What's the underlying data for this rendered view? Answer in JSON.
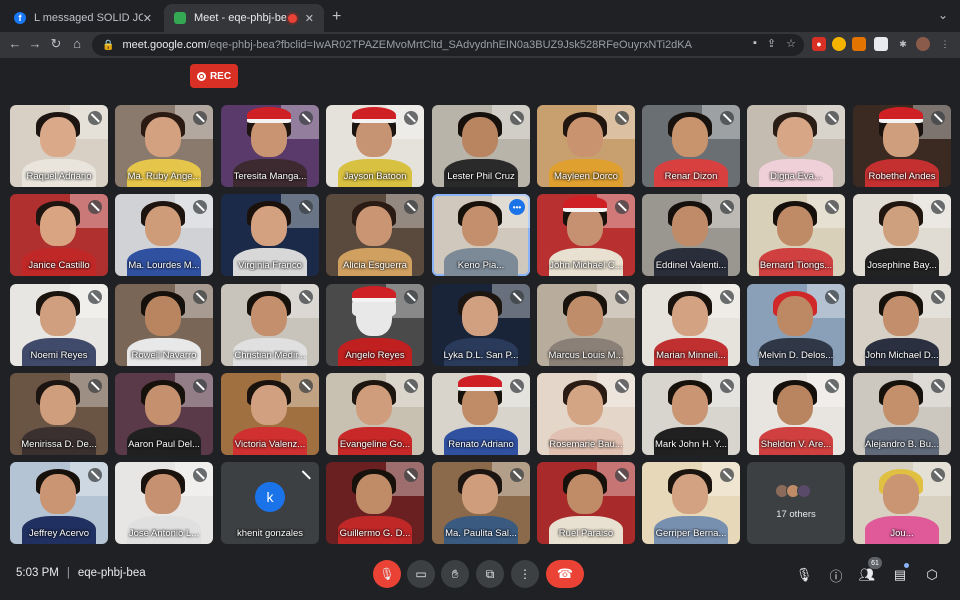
{
  "browser": {
    "tabs": [
      {
        "title": "L messaged SOLID JOKAK Ma",
        "favicon": "facebook-icon",
        "color": "#1877f2",
        "active": false
      },
      {
        "title": "Meet - eqe-phbj-bea",
        "favicon": "meet-icon",
        "color": "#34a853",
        "active": true
      }
    ],
    "url_host": "meet.google.com",
    "url_path": "/eqe-phbj-bea?fbclid=IwAR02TPAZEMvoMrtCltd_SAdvydnhEIN0a3BUZ9Jsk528RFeOuyrxNTi2dKA"
  },
  "meeting": {
    "rec_label": "REC",
    "time": "5:03 PM",
    "code": "eqe-phbj-bea",
    "participants_count": "61"
  },
  "participants": [
    {
      "name": "Raquel Adriano",
      "bg": "#d8d0c4",
      "skin": "#d9a98a",
      "hair": "#1b1410",
      "shirt": "#e9e4dc",
      "hat": false
    },
    {
      "name": "Ma. Ruby Ange...",
      "bg": "#8a7a6e",
      "skin": "#d3a080",
      "hair": "#2a1a12",
      "shirt": "#e6c64a",
      "hat": false
    },
    {
      "name": "Teresita Manga...",
      "bg": "#5a3a6a",
      "skin": "#c99472",
      "hair": "#1e1410",
      "shirt": "#3d2a30",
      "hat": true
    },
    {
      "name": "Jayson Batoon",
      "bg": "#e5e2dc",
      "skin": "#c79473",
      "hair": "#1c1410",
      "shirt": "#d8c040",
      "hat": true
    },
    {
      "name": "Lester Phil Cruz",
      "bg": "#b8b4aa",
      "skin": "#b98460",
      "hair": "#15100c",
      "shirt": "#2a2a2a",
      "hat": false
    },
    {
      "name": "Mayleen Dorco",
      "bg": "#c8a070",
      "skin": "#c9936f",
      "hair": "#20160f",
      "shirt": "#e0a030",
      "hat": false
    },
    {
      "name": "Renar Dizon",
      "bg": "#6a6f74",
      "skin": "#c8946e",
      "hair": "#18120e",
      "shirt": "#d84040",
      "hat": false
    },
    {
      "name": "Digna Eva...",
      "bg": "#c4bcb0",
      "skin": "#d6a687",
      "hair": "#2a1d16",
      "shirt": "#f0d0d8",
      "hat": false
    },
    {
      "name": "Robethel Andes",
      "bg": "#3a2a22",
      "skin": "#cf9e7c",
      "hair": "#1a120e",
      "shirt": "#c43030",
      "hat": true
    },
    {
      "name": "Janice Castillo",
      "bg": "#b03030",
      "skin": "#d8a482",
      "hair": "#1e1510",
      "shirt": "#c02828",
      "hat": false
    },
    {
      "name": "Ma. Lourdes M...",
      "bg": "#d0d2d6",
      "skin": "#cf9c7a",
      "hair": "#1d1410",
      "shirt": "#3050a0",
      "hat": false
    },
    {
      "name": "Virginia Franco",
      "bg": "#1a2a48",
      "skin": "#d3a080",
      "hair": "#1a110c",
      "shirt": "#d8d8d8",
      "hat": false
    },
    {
      "name": "Alicia Esguerra",
      "bg": "#5a4a3e",
      "skin": "#c99573",
      "hair": "#2a1c14",
      "shirt": "#d0a060",
      "hat": false
    },
    {
      "name": "Keno Pia...",
      "bg": "#d0c8bc",
      "skin": "#c48f6c",
      "hair": "#17110c",
      "shirt": "#7c8a98",
      "hat": false
    },
    {
      "name": "John Michael C...",
      "bg": "#b83030",
      "skin": "#c59170",
      "hair": "#1a120d",
      "shirt": "#e8e0d0",
      "hat": true
    },
    {
      "name": "Eddinel Valenti...",
      "bg": "#9a9690",
      "skin": "#c08b68",
      "hair": "#16100c",
      "shirt": "#2a2e3a",
      "hat": false
    },
    {
      "name": "Bernard Tiongs...",
      "bg": "#d8d0b8",
      "skin": "#bf8a66",
      "hair": "#16100c",
      "shirt": "#d04040",
      "hat": false
    },
    {
      "name": "Josephine Bay...",
      "bg": "#e0dcd4",
      "skin": "#cfa07e",
      "hair": "#20160f",
      "shirt": "#222222",
      "hat": false
    },
    {
      "name": "Noemi Reyes",
      "bg": "#e8e6e2",
      "skin": "#cf9f80",
      "hair": "#1b130e",
      "shirt": "#404a6a",
      "hat": false
    },
    {
      "name": "Rowell Navarro",
      "bg": "#7a6656",
      "skin": "#b98560",
      "hair": "#15100c",
      "shirt": "#e8e8e8",
      "hat": false
    },
    {
      "name": "Christian Medir...",
      "bg": "#c8c4bc",
      "skin": "#c48f6c",
      "hair": "#17110c",
      "shirt": "#e0e0e0",
      "hat": false
    },
    {
      "name": "Angelo Reyes",
      "bg": "#4a4a4a",
      "skin": "#e8e8e8",
      "hair": "#e8e8e8",
      "shirt": "#c02020",
      "hat": true
    },
    {
      "name": "Lyka D.L. San P...",
      "bg": "#1a2438",
      "skin": "#d0a080",
      "hair": "#1d1510",
      "shirt": "#2a3a5a",
      "hat": false
    },
    {
      "name": "Marcus Louis M...",
      "bg": "#b8ac9c",
      "skin": "#c08d6a",
      "hair": "#18120d",
      "shirt": "#8a8078",
      "hat": false
    },
    {
      "name": "Marian Minneli...",
      "bg": "#e6e2dc",
      "skin": "#d2a282",
      "hair": "#1a120d",
      "shirt": "#c03030",
      "hat": false
    },
    {
      "name": "Melvin D. Delos...",
      "bg": "#8aa0b8",
      "skin": "#bd8864",
      "hair": "#d02828",
      "shirt": "#303848",
      "hat": false
    },
    {
      "name": "John Michael D...",
      "bg": "#d6d0c6",
      "skin": "#c28e6b",
      "hair": "#17110c",
      "shirt": "#2a3040",
      "hat": false
    },
    {
      "name": "Menirissa D. De...",
      "bg": "#6a5444",
      "skin": "#cf9e7d",
      "hair": "#1c1410",
      "shirt": "#3a3030",
      "hat": false
    },
    {
      "name": "Aaron Paul Del...",
      "bg": "#5a3a48",
      "skin": "#c4906d",
      "hair": "#17110c",
      "shirt": "#202020",
      "hat": false
    },
    {
      "name": "Victoria Valenz...",
      "bg": "#a07040",
      "skin": "#d0a080",
      "hair": "#1a120d",
      "shirt": "#d03030",
      "hat": false
    },
    {
      "name": "Evangeline Go...",
      "bg": "#c8c0b0",
      "skin": "#cf9d7c",
      "hair": "#1d1510",
      "shirt": "#c82828",
      "hat": false
    },
    {
      "name": "Renato Adriano",
      "bg": "#d8d4cc",
      "skin": "#c08c68",
      "hair": "#17110c",
      "shirt": "#3050a0",
      "hat": true
    },
    {
      "name": "Rosemarie Bau...",
      "bg": "#e4d6c8",
      "skin": "#d4a584",
      "hair": "#2a1c14",
      "shirt": "#e0c0b0",
      "hat": false
    },
    {
      "name": "Mark John H. Y...",
      "bg": "#d8d4ce",
      "skin": "#c99573",
      "hair": "#17110c",
      "shirt": "#202020",
      "hat": false
    },
    {
      "name": "Sheldon V. Are...",
      "bg": "#e8e4e0",
      "skin": "#b98460",
      "hair": "#16100c",
      "shirt": "#d04040",
      "hat": false
    },
    {
      "name": "Alejandro B. Bu...",
      "bg": "#ccc8c0",
      "skin": "#c48f6b",
      "hair": "#17110c",
      "shirt": "#606a7a",
      "hat": false
    },
    {
      "name": "Jeffrey Acervo",
      "bg": "#b4c4d4",
      "skin": "#c99572",
      "hair": "#17110c",
      "shirt": "#203060",
      "hat": false
    },
    {
      "name": "Jose Antonio L...",
      "bg": "#e8e6e4",
      "skin": "#c59170",
      "hair": "#1a120d",
      "shirt": "#e0e0e0",
      "hat": false
    },
    {
      "type": "avatar",
      "name": "khenit gonzales",
      "letter": "k"
    },
    {
      "name": "Guillermo G. D...",
      "bg": "#6a2020",
      "skin": "#c08c68",
      "hair": "#17110c",
      "shirt": "#c02828",
      "hat": false
    },
    {
      "name": "Ma. Paulita Sal...",
      "bg": "#8a6a4a",
      "skin": "#cf9d7c",
      "hair": "#1c1410",
      "shirt": "#3a5a80",
      "hat": false
    },
    {
      "name": "Ruel Paraiso",
      "bg": "#a82a2a",
      "skin": "#c08b67",
      "hair": "#17110c",
      "shirt": "#e8e0d0",
      "hat": false
    },
    {
      "name": "Gerriper Berna...",
      "bg": "#e6d8b8",
      "skin": "#d2a282",
      "hair": "#1b130e",
      "shirt": "#7890b0",
      "hat": false
    },
    {
      "type": "others",
      "label": "17 others"
    },
    {
      "name": "Jou...",
      "bg": "#d8d0c0",
      "skin": "#c99573",
      "hair": "#e0c040",
      "shirt": "#e05a9a",
      "hat": false
    }
  ],
  "speaking_index": 13,
  "more_options_index": 13
}
